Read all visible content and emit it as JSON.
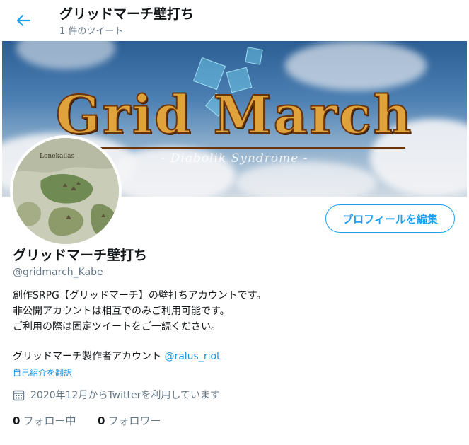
{
  "header": {
    "title": "グリッドマーチ壁打ち",
    "subtitle": "1 件のツイート"
  },
  "banner": {
    "title": "Grid March",
    "subtitle": "- Diabolik Syndrome -"
  },
  "avatar": {
    "map_label": "Lonekailas"
  },
  "actions": {
    "edit_profile_label": "プロフィールを編集"
  },
  "profile": {
    "display_name": "グリッドマーチ壁打ち",
    "handle": "@gridmarch_Kabe",
    "bio_lines": [
      "創作SRPG【グリッドマーチ】の壁打ちアカウントです。",
      "非公開アカウントは相互でのみご利用可能です。",
      "ご利用の際は固定ツイートをご一読ください。"
    ],
    "creator_text": "グリッドマーチ製作者アカウント",
    "creator_mention": "@ralus_riot",
    "translate_label": "自己紹介を翻訳",
    "joined": "2020年12月からTwitterを利用しています"
  },
  "stats": {
    "following_count": "0",
    "following_label": "フォロー中",
    "followers_count": "0",
    "followers_label": "フォロワー"
  },
  "colors": {
    "accent": "#1da1f2",
    "link": "#1b95e0",
    "text": "#14171a",
    "secondary_text": "#657786"
  },
  "icons": {
    "back": "arrow-left-icon",
    "calendar": "calendar-icon"
  }
}
